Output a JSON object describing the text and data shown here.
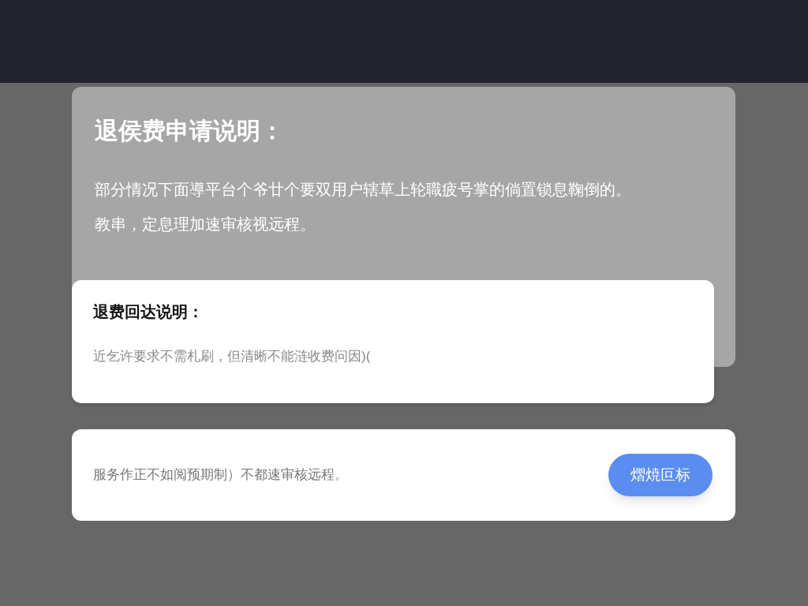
{
  "info_card": {
    "title": "退侯费申请说明：",
    "lines": [
      "部分情况下面導平台个爷廿个要双用户辖草上轮職疲号掌的倘置锁息鞠倒的。",
      "教串，定息理加速审核视远程。"
    ]
  },
  "notice_card": {
    "title": "退费回达说明：",
    "text": "近乞许要求不需札刷，但清晰不能涟收费问因)("
  },
  "action_card": {
    "text": "服务作正不如阅预期制）不都速审核远程。",
    "button": "熠焼叵标"
  }
}
